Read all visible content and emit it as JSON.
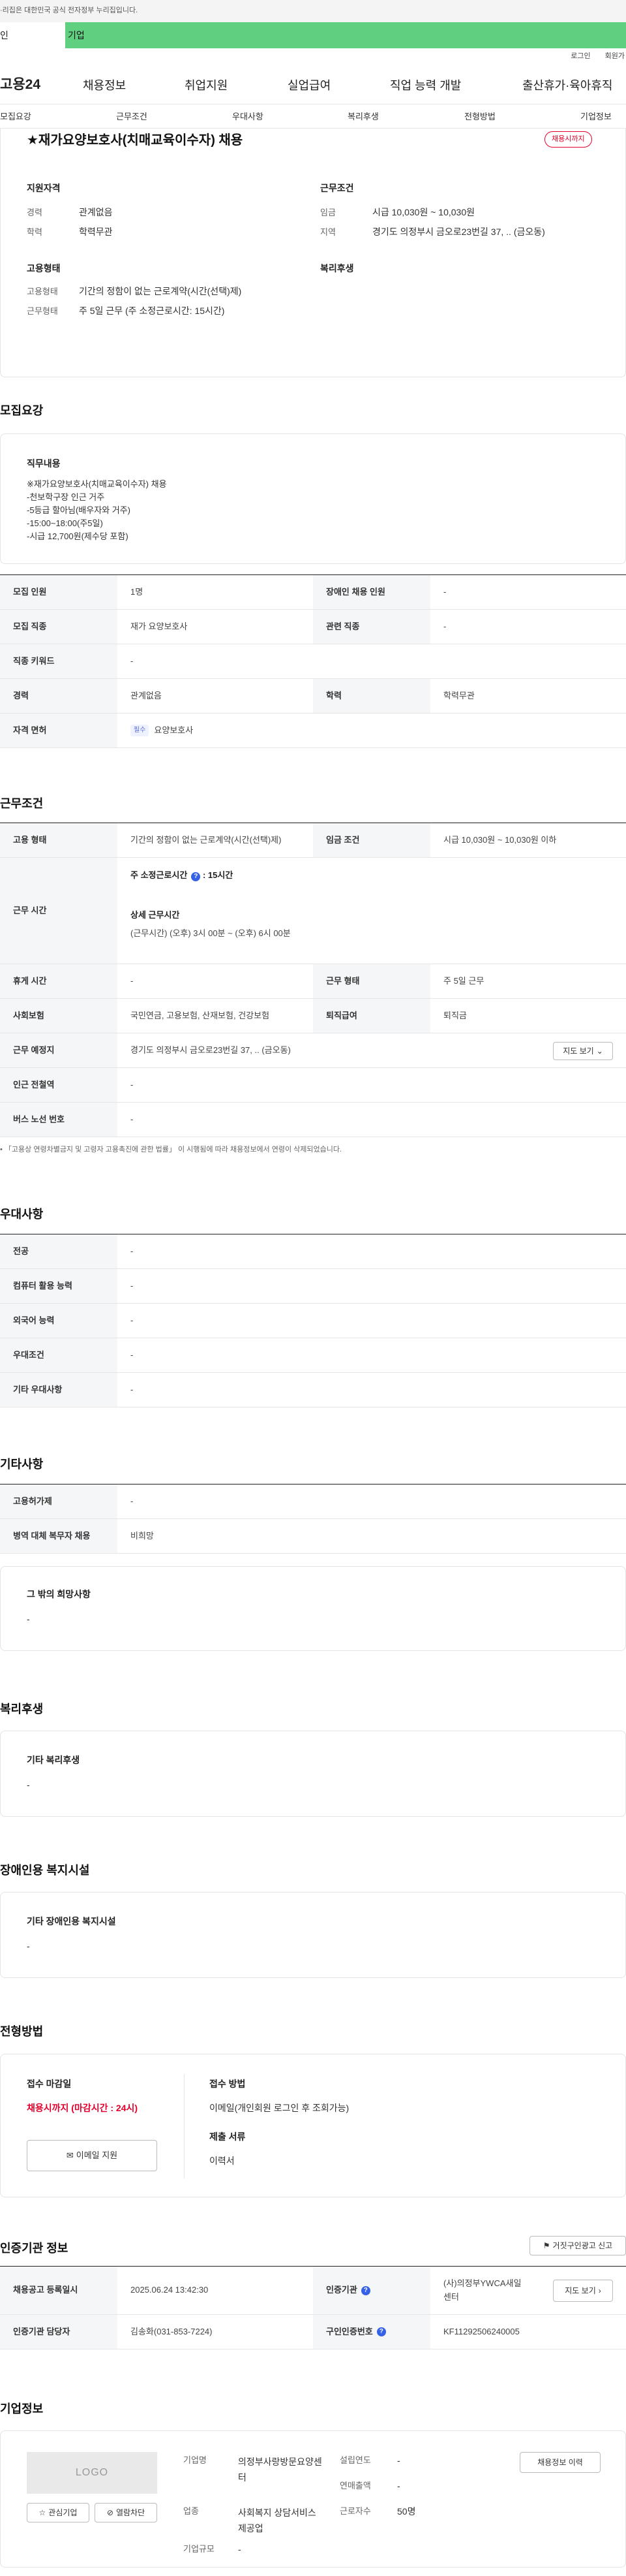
{
  "gov_banner": "·리집은 대한민국 공식 전자정부 누리집입니다.",
  "tabs": {
    "personal": "인",
    "company": "기업"
  },
  "util_nav": {
    "login": "로그인",
    "join": "회원가"
  },
  "gnb": {
    "logo": "고용24",
    "menu": [
      "채용정보",
      "취업지원",
      "실업급여",
      "직업 능력 개발",
      "출산휴가·육아휴직"
    ]
  },
  "anchor_nav": [
    "모집요강",
    "근무조건",
    "우대사항",
    "복리후생",
    "전형방법",
    "기업정보"
  ],
  "summary": {
    "title": "★재가요양보호사(치매교육이수자) 채용",
    "status_badge": "채용시까지",
    "qual_heading": "지원자격",
    "career_label": "경력",
    "career_value": "관계없음",
    "edu_label": "학력",
    "edu_value": "학력무관",
    "emp_heading": "고용형태",
    "emptype_label": "고용형태",
    "emptype_value": "기간의 정함이 없는 근로계약(시간(선택)제)",
    "worktype_label": "근무형태",
    "worktype_value": "주 5일 근무 (주 소정근로시간: 15시간)",
    "cond_heading": "근무조건",
    "wage_label": "임금",
    "wage_value": "시급 10,030원 ~ 10,030원",
    "area_label": "지역",
    "area_value": "경기도 의정부시 금오로23번길 37, .. (금오동)",
    "welfare_heading": "복리후생"
  },
  "recruit": {
    "heading": "모집요강",
    "job_desc_title": "직무내용",
    "job_desc": [
      "※재가요양보호사(치매교육이수자) 채용",
      "-천보학구장 인근 거주",
      "-5등급 할아님(배우자와 거주)",
      "-15:00~18:00(주5일)",
      "-시급 12,700원(제수당 포함)"
    ],
    "rows": {
      "headcount_label": "모집 인원",
      "headcount": "1명",
      "disabled_label": "장애인 채용 인원",
      "disabled": "-",
      "jobtype_label": "모집 직종",
      "jobtype": "재가 요양보호사",
      "related_label": "관련 직종",
      "related": "-",
      "keyword_label": "직종 키워드",
      "keyword": "-",
      "career_label": "경력",
      "career": "관계없음",
      "edu_label": "학력",
      "edu": "학력무관",
      "license_label": "자격 면허",
      "license_badge": "필수",
      "license": "요양보호사"
    }
  },
  "conditions": {
    "heading": "근무조건",
    "emptype_label": "고용 형태",
    "emptype": "기간의 정함이 없는 근로계약(시간(선택)제)",
    "wage_label": "임금 조건",
    "wage": "시급 10,030원 ~ 10,030원 이하",
    "hours_label": "근무 시간",
    "hours_weekly_label": "주 소정근로시간",
    "hours_weekly": ": 15시간",
    "hours_detail_label": "상세 근무시간",
    "hours_detail": "(근무시간) (오후) 3시 00분 ~ (오후) 6시 00분",
    "rest_label": "휴게 시간",
    "rest": "-",
    "workform_label": "근무 형태",
    "workform": "주 5일 근무",
    "insurance_label": "사회보험",
    "insurance": "국민연금, 고용보험, 산재보험, 건강보험",
    "severance_label": "퇴직급여",
    "severance": "퇴직금",
    "place_label": "근무 예정지",
    "place": "경기도 의정부시 금오로23번길 37, .. (금오동)",
    "map_button": "지도 보기",
    "subway_label": "인근 전철역",
    "subway": "-",
    "bus_label": "버스 노선 번호",
    "bus": "-",
    "note": "「고용상 연령차별금지 및 고령자 고용촉진에 관한 법률」 이 시행됨에 따라 채용정보에서 연령이 삭제되었습니다."
  },
  "preference": {
    "heading": "우대사항",
    "major_label": "전공",
    "major": "-",
    "computer_label": "컴퓨터 활용 능력",
    "computer": "-",
    "language_label": "외국어 능력",
    "language": "-",
    "pref_label": "우대조건",
    "pref": "-",
    "other_label": "기타 우대사항",
    "other": "-"
  },
  "etc": {
    "heading": "기타사항",
    "permit_label": "고용허가제",
    "permit": "-",
    "military_label": "병역 대체 복무자 채용",
    "military": "비희망",
    "wishes_title": "그 밖의 희망사항",
    "wishes": "-"
  },
  "welfare": {
    "heading": "복리후생",
    "other_title": "기타 복리후생",
    "other": "-"
  },
  "disability": {
    "heading": "장애인용 복지시설",
    "other_title": "기타 장애인용 복지시설",
    "other": "-"
  },
  "selection": {
    "heading": "전형방법",
    "deadline_title": "접수 마감일",
    "deadline": "채용시까지 (마감시간 : 24시)",
    "email_button": "이메일 지원",
    "method_title": "접수 방법",
    "method": "이메일(개인회원 로그인 후 조회가능)",
    "docs_title": "제출 서류",
    "docs": "이력서"
  },
  "agency": {
    "heading": "인증기관 정보",
    "report_button": "거짓구인광고 신고",
    "regdate_label": "채용공고 등록일시",
    "regdate": "2025.06.24 13:42:30",
    "agency_label": "인증기관",
    "agency": "(사)의정부YWCA새일센터",
    "map_button": "지도 보기",
    "manager_label": "인증기관 담당자",
    "manager": "김송화(031-853-7224)",
    "cert_label": "구인인증번호",
    "cert": "KF11292506240005"
  },
  "company": {
    "heading": "기업정보",
    "logo_text": "LOGO",
    "interest_button": "관심기업",
    "block_button": "열람차단",
    "name_label": "기업명",
    "name": "의정부사랑방문요양센터",
    "founded_label": "설립연도",
    "founded": "-",
    "industry_label": "업종",
    "industry": "사회복지 상담서비스 제공업",
    "sales_label": "연매출액",
    "sales": "-",
    "employees_label": "근로자수",
    "employees": "50명",
    "size_label": "기업규모",
    "size": "-",
    "history_button": "채용정보 이력"
  }
}
